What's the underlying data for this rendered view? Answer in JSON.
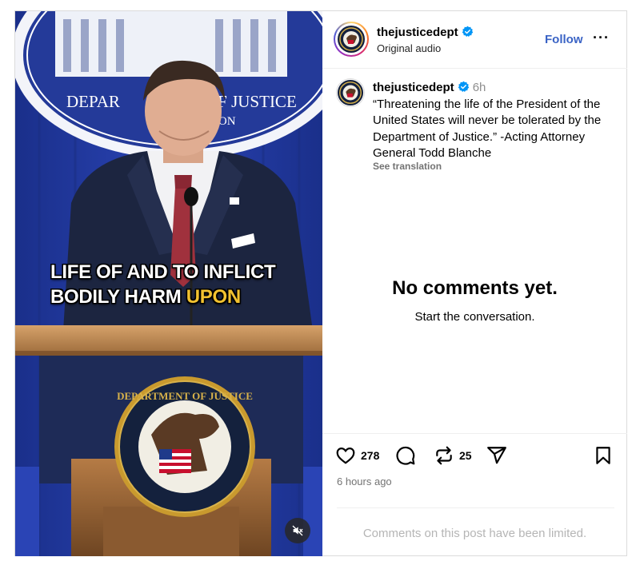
{
  "video": {
    "backdrop_text_top": "DEPAR",
    "backdrop_text_right": "OF JUSTICE",
    "backdrop_text_sub": "TON",
    "subtitle_line1": "LIFE OF AND TO INFLICT",
    "subtitle_line2_a": "BODILY HARM ",
    "subtitle_line2_b": "UPON",
    "seal_text": "DEPARTMENT OF JUSTICE",
    "mute_icon": "speaker-muted-icon"
  },
  "header": {
    "username": "thejusticedept",
    "audio": "Original audio",
    "follow_label": "Follow",
    "more_label": "···"
  },
  "caption": {
    "username": "thejusticedept",
    "time_ago": "6h",
    "text": "“Threatening the life of the President of the United States will never be tolerated by the Department of Justice.” -Acting Attorney General Todd Blanche",
    "see_translation": "See translation"
  },
  "comments": {
    "empty_title": "No comments yet.",
    "empty_subtitle": "Start the conversation."
  },
  "actions": {
    "likes": "278",
    "reposts": "25",
    "timestamp": "6 hours ago",
    "limited_notice": "Comments on this post have been limited."
  },
  "colors": {
    "accent": "#3a63c5",
    "verified": "#0095f6",
    "muted_text": "#737373",
    "limited_text": "#b5b5b5"
  }
}
